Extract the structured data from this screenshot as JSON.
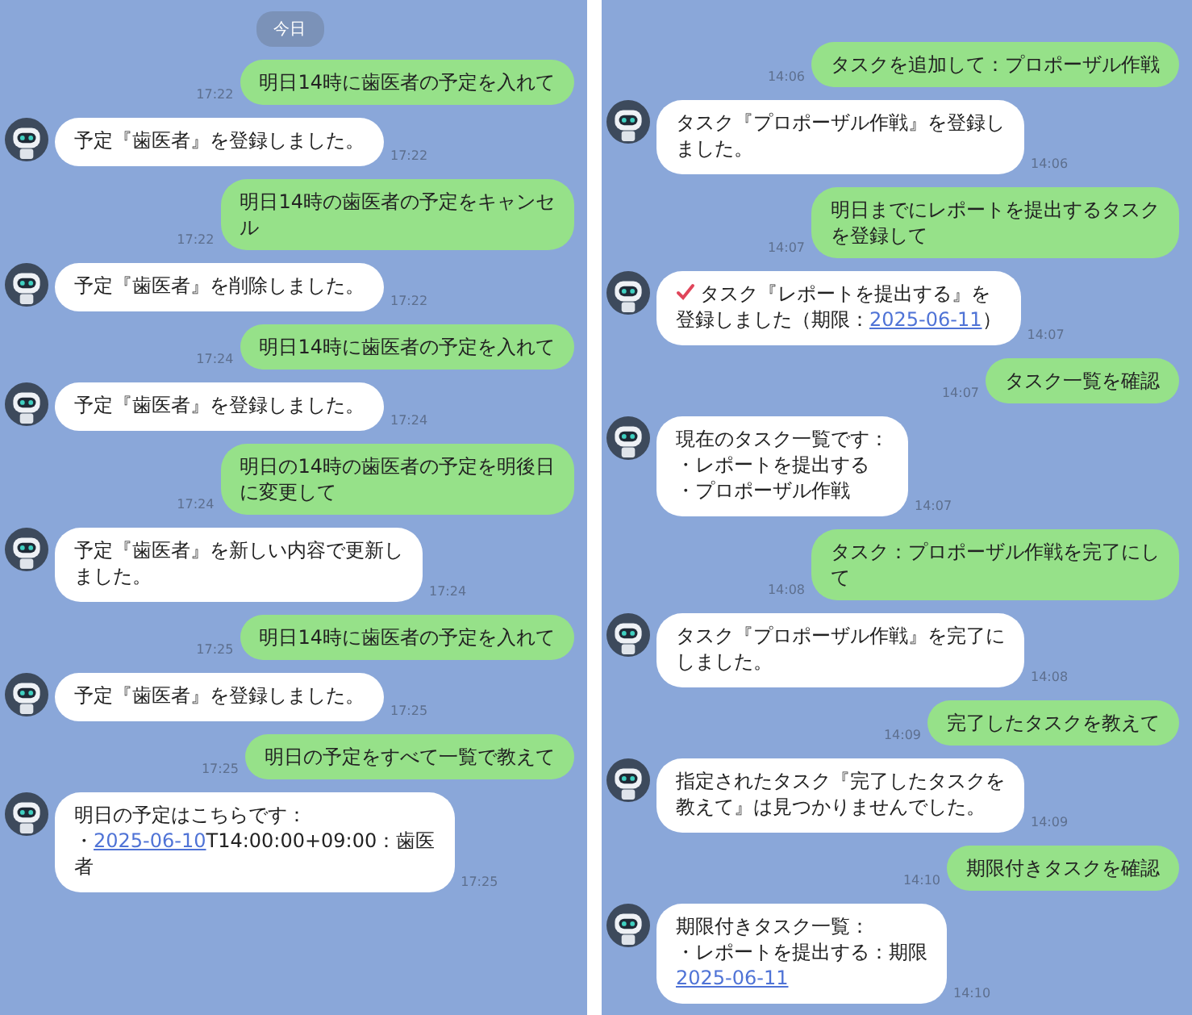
{
  "panels": [
    {
      "date_label": "今日",
      "messages": [
        {
          "kind": "user",
          "lines": [
            "明日14時に歯医者の予定を入れて"
          ],
          "time": "17:22"
        },
        {
          "kind": "bot",
          "marked": false,
          "lines": [
            [
              {
                "kind": "text",
                "text": "予定『歯医者』を登録しました。"
              }
            ]
          ],
          "time": "17:22"
        },
        {
          "kind": "user",
          "lines": [
            "明日14時の歯医者の予定をキャンセ",
            "ル"
          ],
          "time": "17:22"
        },
        {
          "kind": "bot",
          "marked": false,
          "lines": [
            [
              {
                "kind": "text",
                "text": "予定『歯医者』を削除しました。"
              }
            ]
          ],
          "time": "17:22"
        },
        {
          "kind": "user",
          "lines": [
            "明日14時に歯医者の予定を入れて"
          ],
          "time": "17:24"
        },
        {
          "kind": "bot",
          "marked": false,
          "lines": [
            [
              {
                "kind": "text",
                "text": "予定『歯医者』を登録しました。"
              }
            ]
          ],
          "time": "17:24"
        },
        {
          "kind": "user",
          "lines": [
            "明日の14時の歯医者の予定を明後日",
            "に変更して"
          ],
          "time": "17:24"
        },
        {
          "kind": "bot",
          "marked": false,
          "lines": [
            [
              {
                "kind": "text",
                "text": "予定『歯医者』を新しい内容で更新し"
              }
            ],
            [
              {
                "kind": "text",
                "text": "ました。"
              }
            ]
          ],
          "time": "17:24"
        },
        {
          "kind": "user",
          "lines": [
            "明日14時に歯医者の予定を入れて"
          ],
          "time": "17:25"
        },
        {
          "kind": "bot",
          "marked": false,
          "lines": [
            [
              {
                "kind": "text",
                "text": "予定『歯医者』を登録しました。"
              }
            ]
          ],
          "time": "17:25"
        },
        {
          "kind": "user",
          "lines": [
            "明日の予定をすべて一覧で教えて"
          ],
          "time": "17:25"
        },
        {
          "kind": "bot",
          "marked": false,
          "lines": [
            [
              {
                "kind": "text",
                "text": "明日の予定はこちらです："
              }
            ],
            [
              {
                "kind": "text",
                "text": "・"
              },
              {
                "kind": "link",
                "text": "2025-06-10"
              },
              {
                "kind": "text",
                "text": "T14:00:00+09:00：歯医"
              }
            ],
            [
              {
                "kind": "text",
                "text": "者"
              }
            ]
          ],
          "time": "17:25"
        }
      ]
    },
    {
      "messages": [
        {
          "kind": "user",
          "lines": [
            "タスクを追加して：プロポーザル作戦"
          ],
          "time": "14:06"
        },
        {
          "kind": "bot",
          "marked": false,
          "lines": [
            [
              {
                "kind": "text",
                "text": "タスク『プロポーザル作戦』を登録し"
              }
            ],
            [
              {
                "kind": "text",
                "text": "ました。"
              }
            ]
          ],
          "time": "14:06"
        },
        {
          "kind": "user",
          "lines": [
            "明日までにレポートを提出するタスク",
            "を登録して"
          ],
          "time": "14:07"
        },
        {
          "kind": "bot",
          "marked": true,
          "lines": [
            [
              {
                "kind": "text",
                "text": "タスク『レポートを提出する』を"
              }
            ],
            [
              {
                "kind": "text",
                "text": "登録しました（期限："
              },
              {
                "kind": "link",
                "text": "2025-06-11"
              },
              {
                "kind": "text",
                "text": "）"
              }
            ]
          ],
          "time": "14:07"
        },
        {
          "kind": "user",
          "lines": [
            "タスク一覧を確認"
          ],
          "time": "14:07"
        },
        {
          "kind": "bot",
          "marked": false,
          "lines": [
            [
              {
                "kind": "text",
                "text": "現在のタスク一覧です："
              }
            ],
            [
              {
                "kind": "text",
                "text": "・レポートを提出する"
              }
            ],
            [
              {
                "kind": "text",
                "text": "・プロポーザル作戦"
              }
            ]
          ],
          "time": "14:07"
        },
        {
          "kind": "user",
          "lines": [
            "タスク：プロポーザル作戦を完了にし",
            "て"
          ],
          "time": "14:08"
        },
        {
          "kind": "bot",
          "marked": false,
          "lines": [
            [
              {
                "kind": "text",
                "text": "タスク『プロポーザル作戦』を完了に"
              }
            ],
            [
              {
                "kind": "text",
                "text": "しました。"
              }
            ]
          ],
          "time": "14:08"
        },
        {
          "kind": "user",
          "lines": [
            "完了したタスクを教えて"
          ],
          "time": "14:09"
        },
        {
          "kind": "bot",
          "marked": false,
          "lines": [
            [
              {
                "kind": "text",
                "text": "指定されたタスク『完了したタスクを"
              }
            ],
            [
              {
                "kind": "text",
                "text": "教えて』は見つかりませんでした。"
              }
            ]
          ],
          "time": "14:09"
        },
        {
          "kind": "user",
          "lines": [
            "期限付きタスクを確認"
          ],
          "time": "14:10"
        },
        {
          "kind": "bot",
          "marked": false,
          "lines": [
            [
              {
                "kind": "text",
                "text": "期限付きタスク一覧："
              }
            ],
            [
              {
                "kind": "text",
                "text": "・レポートを提出する：期限"
              }
            ],
            [
              {
                "kind": "link",
                "text": "2025-06-11"
              }
            ]
          ],
          "time": "14:10"
        }
      ]
    }
  ]
}
